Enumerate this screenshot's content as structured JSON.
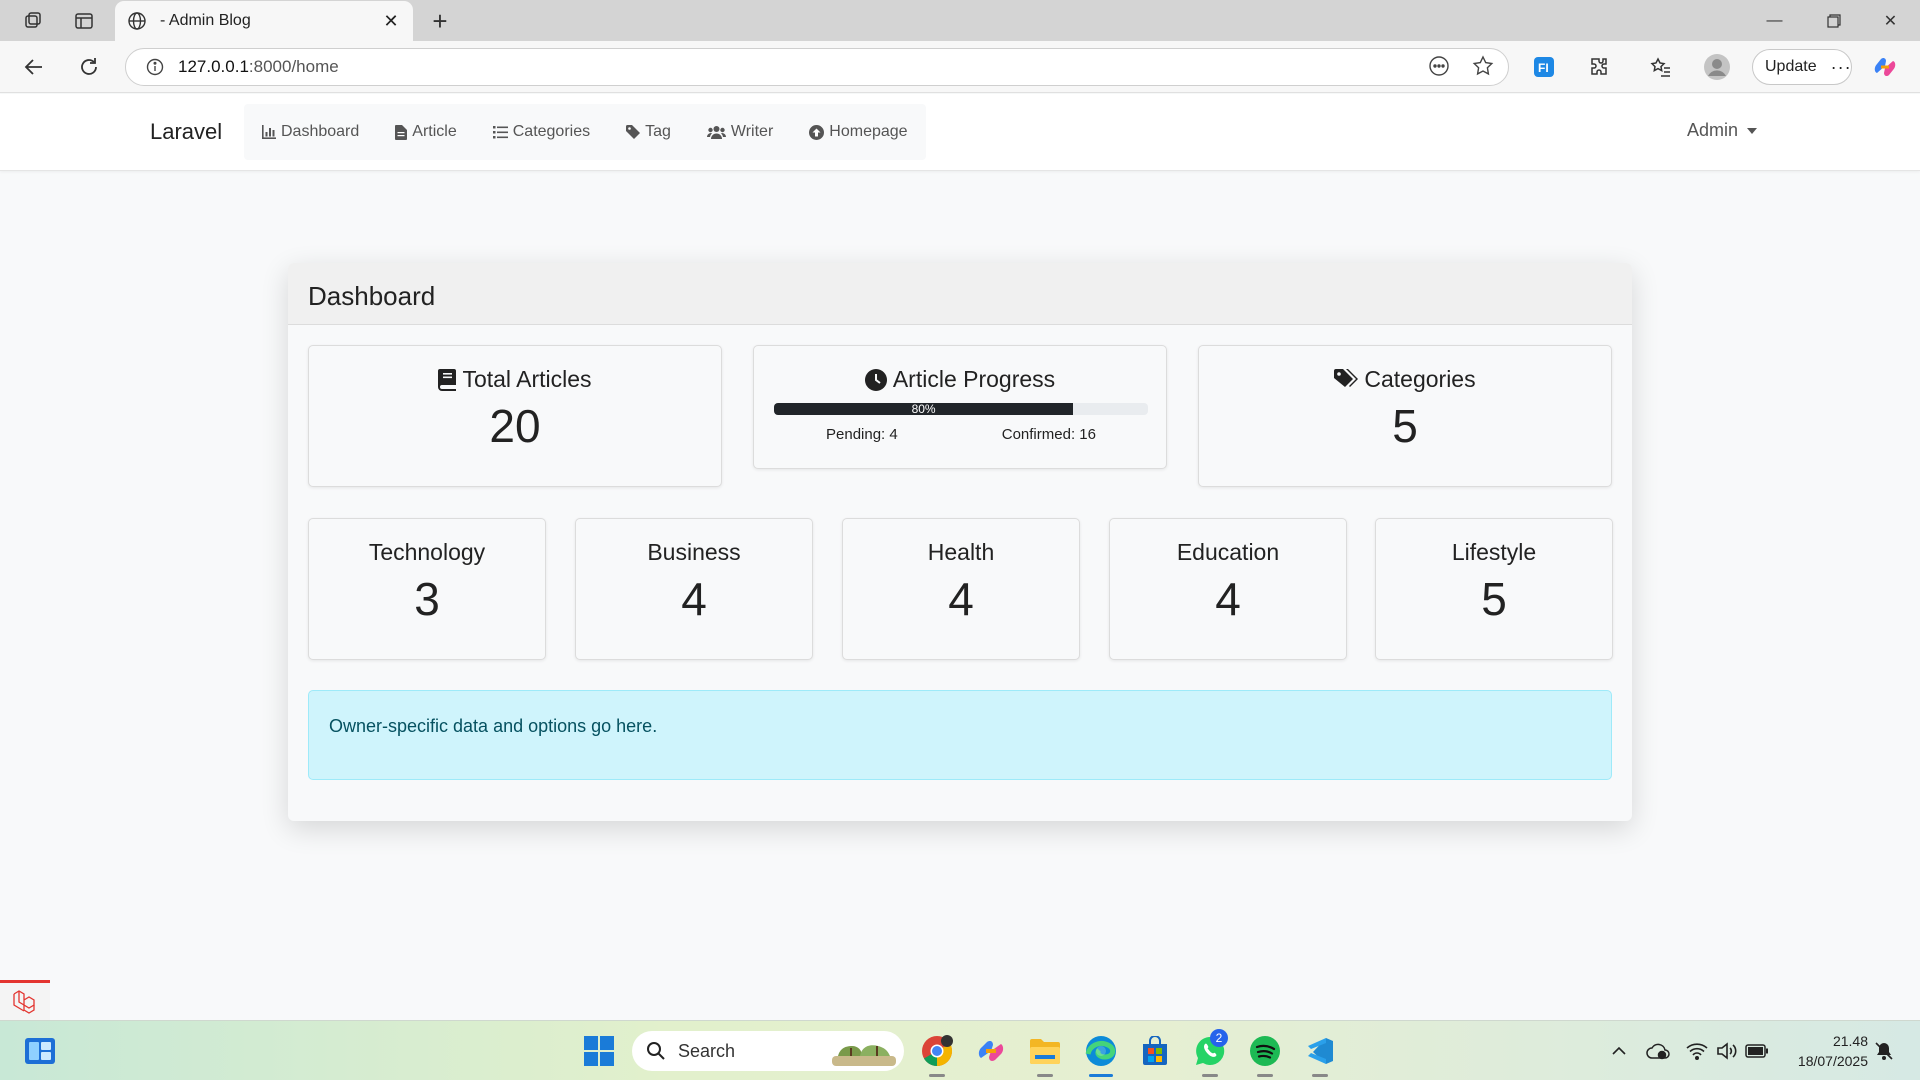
{
  "browser": {
    "tab_title": "- Admin Blog",
    "url_host": "127.0.0.1",
    "url_path": ":8000/home",
    "update_label": "Update"
  },
  "navbar": {
    "brand": "Laravel",
    "items": [
      {
        "label": "Dashboard",
        "icon": "chart-bar-icon"
      },
      {
        "label": "Article",
        "icon": "file-icon"
      },
      {
        "label": "Categories",
        "icon": "list-icon"
      },
      {
        "label": "Tag",
        "icon": "tag-icon"
      },
      {
        "label": "Writer",
        "icon": "users-icon"
      },
      {
        "label": "Homepage",
        "icon": "circle-up-icon"
      }
    ],
    "user": "Admin"
  },
  "dashboard": {
    "title": "Dashboard",
    "total_articles": {
      "label": "Total Articles",
      "value": "20"
    },
    "article_progress": {
      "label": "Article Progress",
      "percent": 80,
      "percent_label": "80%",
      "pending": "Pending: 4",
      "confirmed": "Confirmed: 16"
    },
    "categories": {
      "label": "Categories",
      "value": "5"
    },
    "category_counts": [
      {
        "label": "Technology",
        "value": "3"
      },
      {
        "label": "Business",
        "value": "4"
      },
      {
        "label": "Health",
        "value": "4"
      },
      {
        "label": "Education",
        "value": "4"
      },
      {
        "label": "Lifestyle",
        "value": "5"
      }
    ],
    "owner_note": "Owner-specific data and options go here."
  },
  "taskbar": {
    "search_placeholder": "Search",
    "whatsapp_badge": "2",
    "time": "21.48",
    "date": "18/07/2025"
  },
  "colors": {
    "progress_fill": "#212529",
    "alert_bg": "#cff4fc",
    "alert_text": "#055160"
  }
}
